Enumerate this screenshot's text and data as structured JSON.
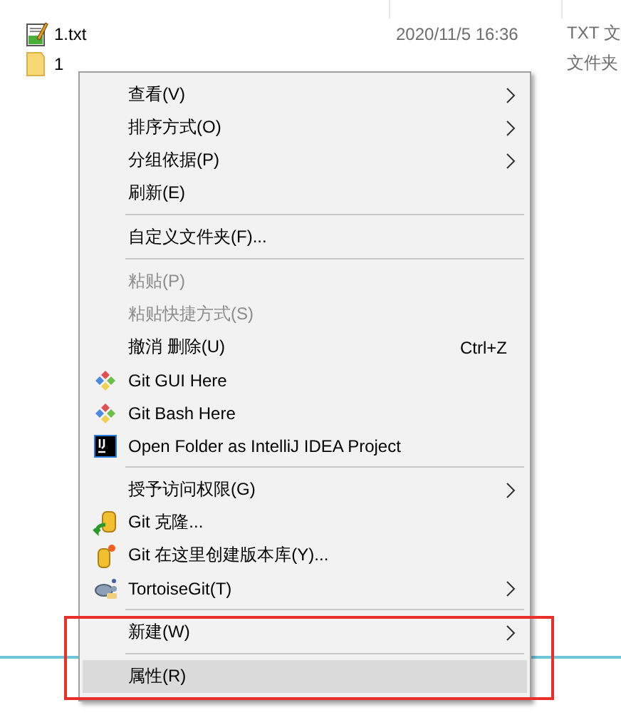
{
  "files": [
    {
      "name": "1.txt",
      "date": "2020/11/5 16:36",
      "type": "TXT 文"
    },
    {
      "name": "1",
      "type": "文件夹"
    }
  ],
  "menu": [
    {
      "kind": "item",
      "label": "查看(V)",
      "submenu": true,
      "disabled": false,
      "selected": false
    },
    {
      "kind": "item",
      "label": "排序方式(O)",
      "submenu": true,
      "disabled": false,
      "selected": false
    },
    {
      "kind": "item",
      "label": "分组依据(P)",
      "submenu": true,
      "disabled": false,
      "selected": false
    },
    {
      "kind": "item",
      "label": "刷新(E)",
      "submenu": false,
      "disabled": false,
      "selected": false
    },
    {
      "kind": "separator"
    },
    {
      "kind": "item",
      "label": "自定义文件夹(F)...",
      "submenu": false,
      "disabled": false,
      "selected": false
    },
    {
      "kind": "separator"
    },
    {
      "kind": "item",
      "label": "粘贴(P)",
      "submenu": false,
      "disabled": true,
      "selected": false
    },
    {
      "kind": "item",
      "label": "粘贴快捷方式(S)",
      "submenu": false,
      "disabled": true,
      "selected": false
    },
    {
      "kind": "item",
      "label": "撤消 删除(U)",
      "shortcut": "Ctrl+Z",
      "submenu": false,
      "disabled": false,
      "selected": false
    },
    {
      "kind": "item",
      "label": "Git GUI Here",
      "submenu": false,
      "disabled": false,
      "selected": false
    },
    {
      "kind": "item",
      "label": "Git Bash Here",
      "submenu": false,
      "disabled": false,
      "selected": false
    },
    {
      "kind": "item",
      "label": "Open Folder as IntelliJ IDEA Project",
      "submenu": false,
      "disabled": false,
      "selected": false
    },
    {
      "kind": "separator"
    },
    {
      "kind": "item",
      "label": "授予访问权限(G)",
      "submenu": true,
      "disabled": false,
      "selected": false
    },
    {
      "kind": "item",
      "label": "Git 克隆...",
      "submenu": false,
      "disabled": false,
      "selected": false
    },
    {
      "kind": "item",
      "label": "Git 在这里创建版本库(Y)...",
      "submenu": false,
      "disabled": false,
      "selected": false
    },
    {
      "kind": "item",
      "label": "TortoiseGit(T)",
      "submenu": true,
      "disabled": false,
      "selected": false
    },
    {
      "kind": "separator"
    },
    {
      "kind": "item",
      "label": "新建(W)",
      "submenu": true,
      "disabled": false,
      "selected": false
    },
    {
      "kind": "separator"
    },
    {
      "kind": "item",
      "label": "属性(R)",
      "submenu": false,
      "disabled": false,
      "selected": true
    }
  ]
}
